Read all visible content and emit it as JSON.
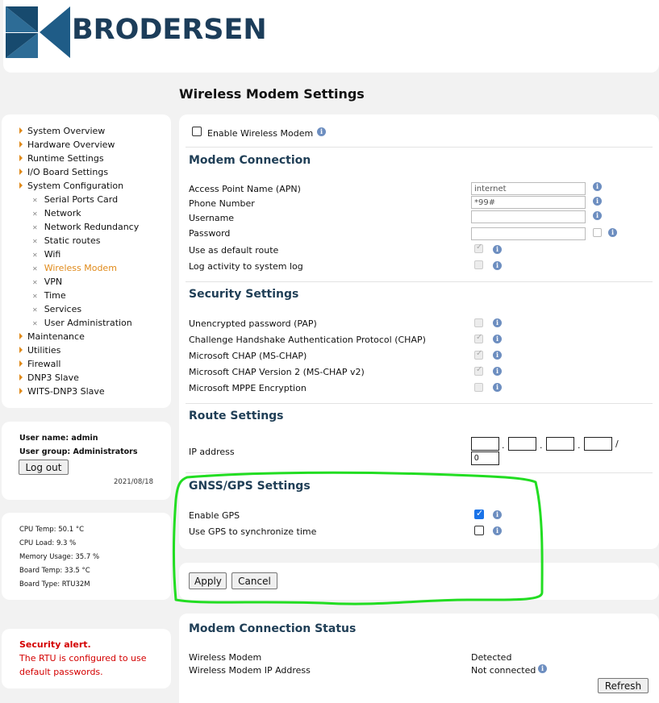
{
  "brand": {
    "logo_text": "BRODERSEN"
  },
  "page_title": "Wireless Modem Settings",
  "nav": {
    "items": [
      {
        "label": "System Overview"
      },
      {
        "label": "Hardware Overview"
      },
      {
        "label": "Runtime Settings"
      },
      {
        "label": "I/O Board Settings"
      },
      {
        "label": "System Configuration"
      }
    ],
    "sub_items": [
      {
        "label": "Serial Ports Card"
      },
      {
        "label": "Network"
      },
      {
        "label": "Network Redundancy"
      },
      {
        "label": "Static routes"
      },
      {
        "label": "Wifi"
      },
      {
        "label": "Wireless Modem"
      },
      {
        "label": "VPN"
      },
      {
        "label": "Time"
      },
      {
        "label": "Services"
      },
      {
        "label": "User Administration"
      }
    ],
    "items_after": [
      {
        "label": "Maintenance"
      },
      {
        "label": "Utilities"
      },
      {
        "label": "Firewall"
      },
      {
        "label": "DNP3 Slave"
      },
      {
        "label": "WITS-DNP3 Slave"
      }
    ]
  },
  "user": {
    "name_line": "User name: admin",
    "group_line": "User group: Administrators",
    "logout_label": "Log out",
    "date": "2021/08/18"
  },
  "stats": {
    "cpu_temp": "CPU Temp: 50.1 °C",
    "cpu_load": "CPU Load: 9.3 %",
    "memory": "Memory Usage: 35.7 %",
    "board_temp": "Board Temp: 33.5 °C",
    "board_type": "Board Type: RTU32M"
  },
  "alert": {
    "title": "Security alert.",
    "line1": "The RTU is configured to use",
    "line2": "default passwords."
  },
  "form": {
    "enable_label": "Enable Wireless Modem",
    "modem_connection": {
      "title": "Modem Connection",
      "apn_label": "Access Point Name (APN)",
      "apn_value": "internet",
      "phone_label": "Phone Number",
      "phone_value": "*99#",
      "username_label": "Username",
      "username_value": "",
      "password_label": "Password",
      "password_value": "",
      "default_route_label": "Use as default route",
      "log_label": "Log activity to system log"
    },
    "security": {
      "title": "Security Settings",
      "pap_label": "Unencrypted password (PAP)",
      "chap_label": "Challenge Handshake Authentication Protocol (CHAP)",
      "mschap_label": "Microsoft CHAP (MS-CHAP)",
      "mschap2_label": "Microsoft CHAP Version 2 (MS-CHAP v2)",
      "mppe_label": "Microsoft MPPE Encryption"
    },
    "route": {
      "title": "Route Settings",
      "ip_label": "IP address",
      "ip_dot": ".",
      "ip_slash": "/",
      "prefix_value": "0"
    },
    "gnss": {
      "title": "GNSS/GPS Settings",
      "enable_label": "Enable GPS",
      "sync_label": "Use GPS to synchronize time"
    },
    "apply_label": "Apply",
    "cancel_label": "Cancel"
  },
  "status": {
    "title": "Modem Connection Status",
    "modem_label": "Wireless Modem",
    "modem_value": "Detected",
    "ip_label": "Wireless Modem IP Address",
    "ip_value": "Not connected",
    "refresh_label": "Refresh"
  },
  "colors": {
    "accent": "#e08a1a",
    "heading": "#1f3e56",
    "alert": "#d40000",
    "highlight_annotation": "#22dd22"
  }
}
